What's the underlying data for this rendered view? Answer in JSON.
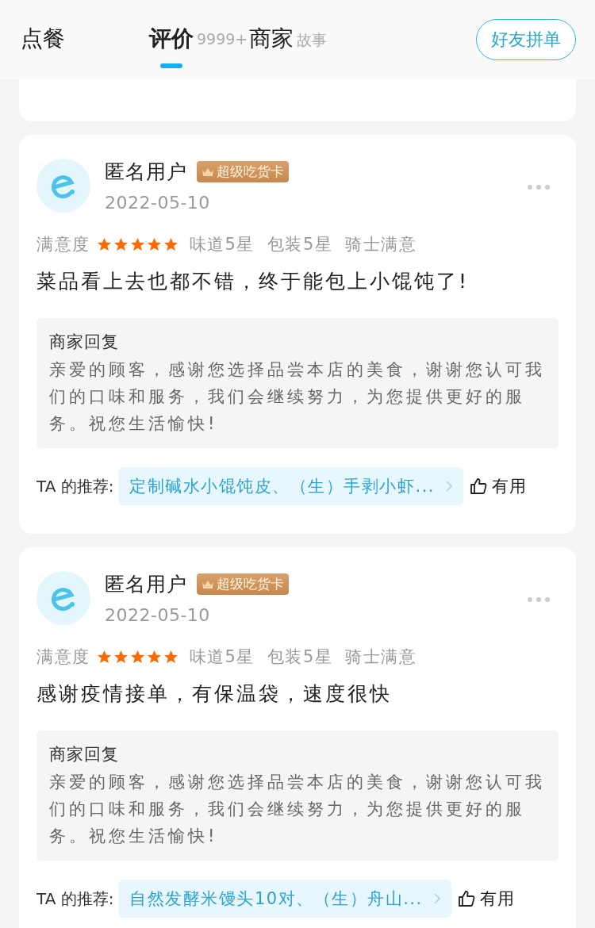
{
  "tabs": [
    {
      "label": "点餐",
      "selected": false
    },
    {
      "label": "评价",
      "count": "9999+",
      "selected": true
    },
    {
      "label": "商家",
      "suffix": "故事",
      "selected": false
    }
  ],
  "header_button": "好友拼单",
  "reviews": [
    {
      "user": "匿名用户",
      "badge": "超级吃货卡",
      "date": "2022-05-10",
      "satisfaction_label": "满意度",
      "stars": 5,
      "ratings": [
        "味道5星",
        "包装5星",
        "骑士满意"
      ],
      "comment": "菜品看上去也都不错，终于能包上小馄饨了!",
      "reply_title": "商家回复",
      "reply": "亲爱的顾客，感谢您选择品尝本店的美食，谢谢您认可我们的口味和服务，我们会继续努力，为您提供更好的服务。祝您生活愉快!",
      "recommend_label": "TA 的推荐:",
      "recommend": "定制碱水小馄饨皮、（生）手剥小虾...",
      "useful": "有用"
    },
    {
      "user": "匿名用户",
      "badge": "超级吃货卡",
      "date": "2022-05-10",
      "satisfaction_label": "满意度",
      "stars": 5,
      "ratings": [
        "味道5星",
        "包装5星",
        "骑士满意"
      ],
      "comment": "感谢疫情接单，有保温袋，速度很快",
      "reply_title": "商家回复",
      "reply": "亲爱的顾客，感谢您选择品尝本店的美食，谢谢您认可我们的口味和服务，我们会继续努力，为您提供更好的服务。祝您生活愉快!",
      "recommend_label": "TA 的推荐:",
      "recommend": "自然发酵米馒头10对、（生）舟山...",
      "useful": "有用"
    }
  ]
}
